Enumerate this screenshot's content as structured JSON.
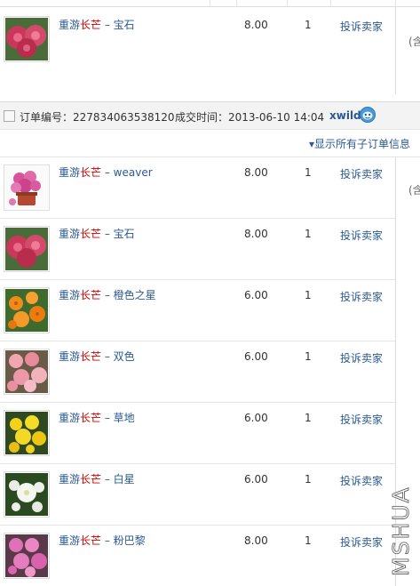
{
  "first_item": {
    "title_prefix": "重游",
    "title_red": "长芒",
    "title_rest": " – 宝石",
    "price": "8.00",
    "qty": "1",
    "complain_label": "投诉卖家",
    "side_note": "(含"
  },
  "order": {
    "order_no_label": "订单编号：",
    "order_no": "227834063538120",
    "time_label": "成交时间：",
    "time_value": "2013-06-10 14:04",
    "seller": "xwild",
    "chat_icon": "wangwang-chat-icon",
    "show_sub_label": "▾显示所有子订单信息",
    "side_note": "(含"
  },
  "items": [
    {
      "prefix": "重游",
      "red": "长芒",
      "rest": " – weaver",
      "price": "8.00",
      "qty": "1",
      "complain": "投诉卖家",
      "thumb": "pink-cyclamen-pot"
    },
    {
      "prefix": "重游",
      "red": "长芒",
      "rest": " – 宝石",
      "price": "8.00",
      "qty": "1",
      "complain": "投诉卖家",
      "thumb": "magenta-rose"
    },
    {
      "prefix": "重游",
      "red": "长芒",
      "rest": " – 橙色之星",
      "price": "6.00",
      "qty": "1",
      "complain": "投诉卖家",
      "thumb": "orange-flowers"
    },
    {
      "prefix": "重游",
      "red": "长芒",
      "rest": " – 双色",
      "price": "6.00",
      "qty": "1",
      "complain": "投诉卖家",
      "thumb": "pink-bicolor"
    },
    {
      "prefix": "重游",
      "red": "长芒",
      "rest": " –  草地",
      "price": "6.00",
      "qty": "1",
      "complain": "投诉卖家",
      "thumb": "yellow-flowers"
    },
    {
      "prefix": "重游",
      "red": "长芒",
      "rest": " – 白星",
      "price": "6.00",
      "qty": "1",
      "complain": "投诉卖家",
      "thumb": "white-flowers"
    },
    {
      "prefix": "重游",
      "red": "长芒",
      "rest": " – 粉巴黎",
      "price": "8.00",
      "qty": "1",
      "complain": "投诉卖家",
      "thumb": "pink-paris"
    }
  ],
  "watermark": "MSHUA",
  "colors": {
    "link": "#2a5a94",
    "accent_red": "#c00",
    "header_bg": "#f3f3f3"
  }
}
